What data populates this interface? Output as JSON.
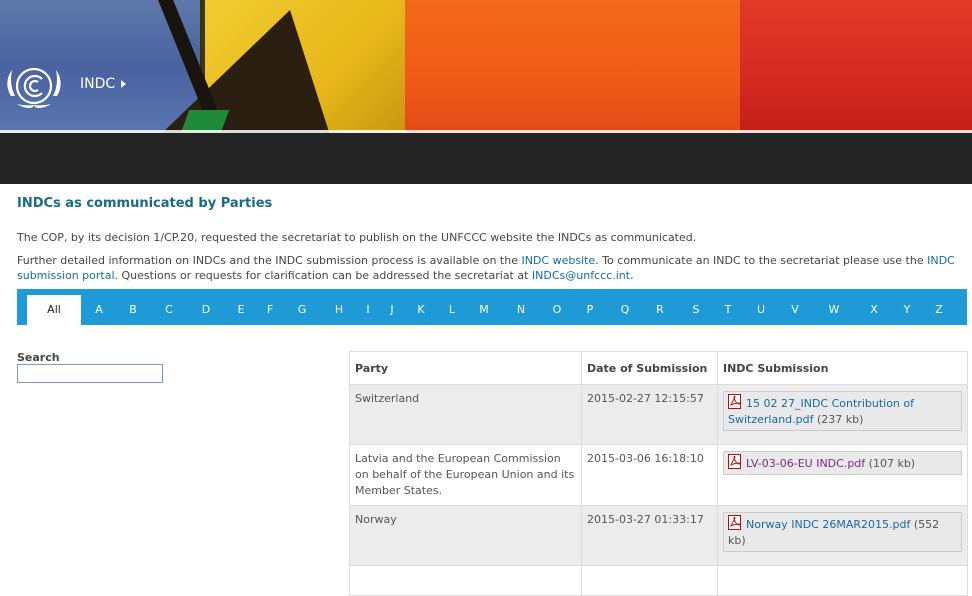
{
  "header": {
    "brand": "INDC"
  },
  "page": {
    "title": "INDCs as communicated by Parties",
    "intro1": "The COP, by its decision 1/CP.20, requested the secretariat to publish on the UNFCCC website the INDCs as communicated.",
    "intro2_a": "Further detailed information on INDCs and the INDC submission process is available on the ",
    "intro2_link1": "INDC website",
    "intro2_b": ". To communicate an INDC to the secretariat please use the ",
    "intro2_link2": "INDC submission portal",
    "intro2_c": ". Questions or requests for clarification can be addressed the secretariat at ",
    "intro2_email": "INDCs@unfccc.int",
    "intro2_d": "."
  },
  "alphabet": [
    "All",
    "A",
    "B",
    "C",
    "D",
    "E",
    "F",
    "G",
    "H",
    "I",
    "J",
    "K",
    "L",
    "M",
    "N",
    "O",
    "P",
    "Q",
    "R",
    "S",
    "T",
    "U",
    "V",
    "W",
    "X",
    "Y",
    "Z"
  ],
  "search": {
    "label": "Search",
    "value": ""
  },
  "table": {
    "headers": [
      "Party",
      "Date of Submission",
      "INDC Submission"
    ],
    "rows": [
      {
        "party": "Switzerland",
        "date": "2015-02-27 12:15:57",
        "file": "15 02 27_INDC Contribution of Switzerland.pdf",
        "size": "(237 kb)"
      },
      {
        "party": "Latvia and the European Commission on behalf of the European Union and its Member States.",
        "date": "2015-03-06 16:18:10",
        "file": "LV-03-06-EU INDC.pdf",
        "size": "(107 kb)"
      },
      {
        "party": "Norway",
        "date": "2015-03-27 01:33:17",
        "file": "Norway INDC 26MAR2015.pdf",
        "size": "(552 kb)"
      }
    ]
  },
  "colors": {
    "accent": "#1e9ad6",
    "title": "#1a6a8a",
    "link": "#1569a6",
    "visited": "#7a2a86",
    "navband": "#242424"
  }
}
